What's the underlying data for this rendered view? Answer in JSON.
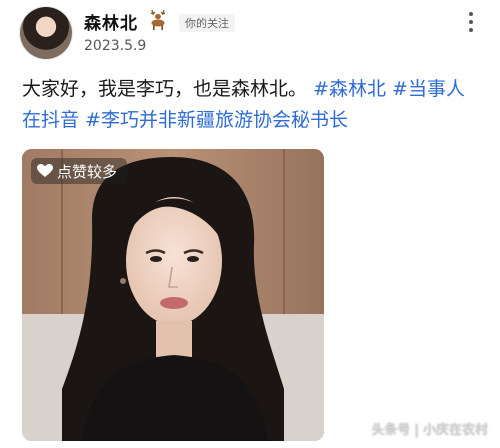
{
  "author": {
    "username": "森林北",
    "badge_icon": "deer-icon",
    "follow_status": "你的关注",
    "date": "2023.5.9"
  },
  "post": {
    "text_intro": "大家好，我是李巧，也是森林北。",
    "hashtags": [
      "#森林北",
      "#当事人在抖音",
      "#李巧并非新疆旅游协会秘书长"
    ]
  },
  "video": {
    "badge_label": "点赞较多",
    "badge_icon": "heart-icon"
  },
  "watermark": "头条号 | 小庆在农村",
  "colors": {
    "hashtag": "#2f6bd4",
    "text": "#1a1a1a",
    "date": "#555555"
  }
}
